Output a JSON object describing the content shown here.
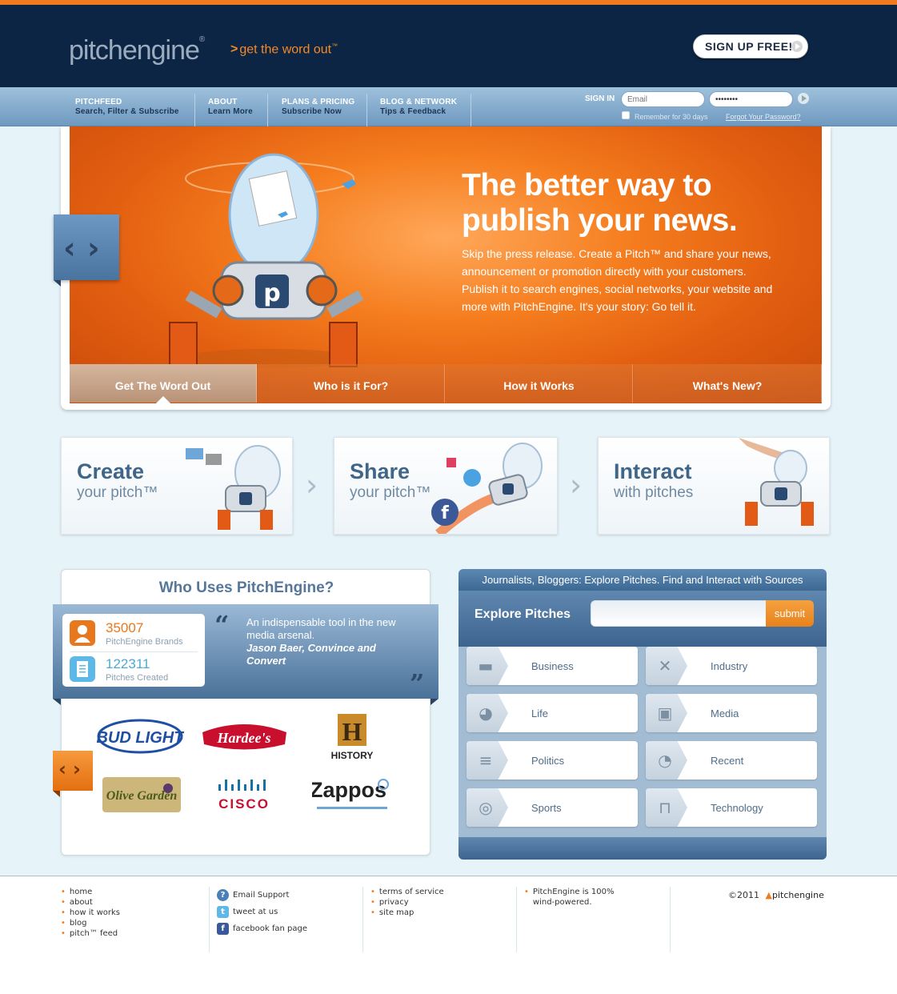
{
  "header": {
    "logo": "pitchengine",
    "tagline": "get the word out",
    "tagline_tm": "™",
    "signup_label": "SIGN UP FREE!"
  },
  "nav": [
    {
      "title": "PITCHFEED",
      "sub": "Search, Filter & Subscribe"
    },
    {
      "title": "ABOUT",
      "sub": "Learn More"
    },
    {
      "title": "PLANS & PRICING",
      "sub": "Subscribe Now"
    },
    {
      "title": "BLOG & NETWORK",
      "sub": "Tips & Feedback"
    }
  ],
  "signin": {
    "label": "SIGN IN",
    "email_placeholder": "Email",
    "password_value": "••••••••",
    "remember": "Remember for 30 days",
    "forgot": "Forgot Your Password?"
  },
  "hero": {
    "title_line1": "The better way to",
    "title_line2": "publish your news.",
    "body": "Skip the press release. Create a Pitch™ and share your news, announcement or promotion directly with your customers. Publish it to search engines, social networks, your website and more with PitchEngine. It's your story: Go tell it.",
    "tabs": [
      "Get The Word Out",
      "Who is it For?",
      "How it Works",
      "What's New?"
    ],
    "active_tab": "Get The Word Out"
  },
  "steps": [
    {
      "big": "Create",
      "small": "your pitch™"
    },
    {
      "big": "Share",
      "small": "your pitch™"
    },
    {
      "big": "Interact",
      "small": "with pitches"
    }
  ],
  "who": {
    "title": "Who Uses PitchEngine?",
    "brands_count": "35007",
    "brands_label": "PitchEngine Brands",
    "pitches_count": "122311",
    "pitches_label": "Pitches Created",
    "quote": "An indispensable tool in the new media arsenal.",
    "author": "Jason Baer, Convince and Convert",
    "logos": [
      "BUD LIGHT",
      "Hardee's",
      "HISTORY",
      "Olive Garden",
      "CISCO",
      "Zappos"
    ]
  },
  "explore": {
    "header": "Journalists, Bloggers: Explore Pitches. Find and Interact with Sources",
    "label": "Explore Pitches",
    "submit": "submit",
    "categories": [
      "Business",
      "Industry",
      "Life",
      "Media",
      "Politics",
      "Recent",
      "Sports",
      "Technology"
    ]
  },
  "footer": {
    "col1": [
      "home",
      "about",
      "how it works",
      "blog",
      "pitch™ feed"
    ],
    "col2": [
      "Email Support",
      "tweet at us",
      "facebook fan page"
    ],
    "col3": [
      "terms of service",
      "privacy",
      "site map"
    ],
    "col4": "PitchEngine is 100% wind-powered.",
    "copyright": "©2011",
    "brand": "pitchengine"
  },
  "colors": {
    "accent": "#f07a1c",
    "header_bg": "#0d2545",
    "nav_bg": "#7fa6cb",
    "page_bg": "#e6f3f8"
  }
}
